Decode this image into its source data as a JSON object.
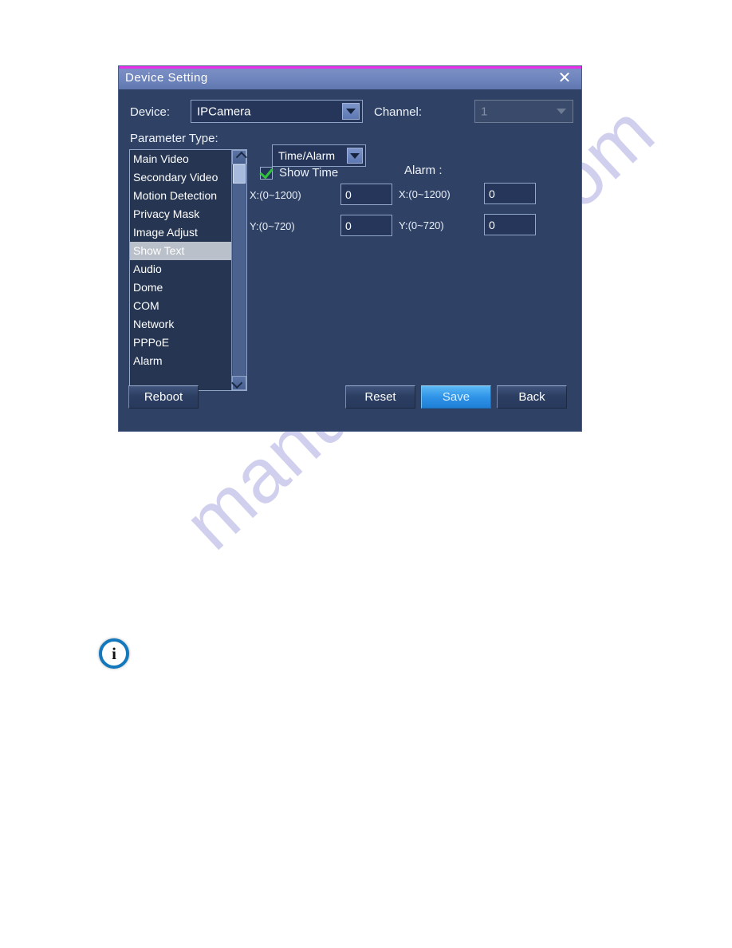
{
  "window": {
    "title": "Device  Setting",
    "close_label": "✕",
    "accent_top": "#e830e8",
    "titlebar_color": "#6f85bd",
    "body_color": "#2f4266"
  },
  "form": {
    "device_label": "Device:",
    "device_value": "IPCamera",
    "channel_label": "Channel:",
    "channel_value": "1",
    "parameter_type_label": "Parameter  Type:"
  },
  "parameter_list": {
    "items": [
      {
        "label": "Main  Video",
        "selected": false
      },
      {
        "label": "Secondary  Video",
        "selected": false
      },
      {
        "label": "Motion  Detection",
        "selected": false
      },
      {
        "label": "Privacy  Mask",
        "selected": false
      },
      {
        "label": "Image  Adjust",
        "selected": false
      },
      {
        "label": "Show  Text",
        "selected": true
      },
      {
        "label": "Audio",
        "selected": false
      },
      {
        "label": "Dome",
        "selected": false
      },
      {
        "label": "COM",
        "selected": false
      },
      {
        "label": "Network",
        "selected": false
      },
      {
        "label": "PPPoE",
        "selected": false
      },
      {
        "label": "Alarm",
        "selected": false
      }
    ]
  },
  "panel": {
    "mode_select_value": "Time/Alarm",
    "show_time_label": "Show  Time",
    "show_time_checked": true,
    "time_x_label": "X:(0~1200)",
    "time_x_value": "0",
    "time_y_label": "Y:(0~720)",
    "time_y_value": "0",
    "alarm_label": "Alarm  :",
    "alarm_x_label": "X:(0~1200)",
    "alarm_x_value": "0",
    "alarm_y_label": "Y:(0~720)",
    "alarm_y_value": "0"
  },
  "buttons": {
    "reboot": "Reboot",
    "reset": "Reset",
    "save": "Save",
    "back": "Back",
    "save_color": "#2f93e8"
  },
  "page": {
    "watermark_text": "manualshive.com",
    "info_icon_glyph": "i"
  }
}
